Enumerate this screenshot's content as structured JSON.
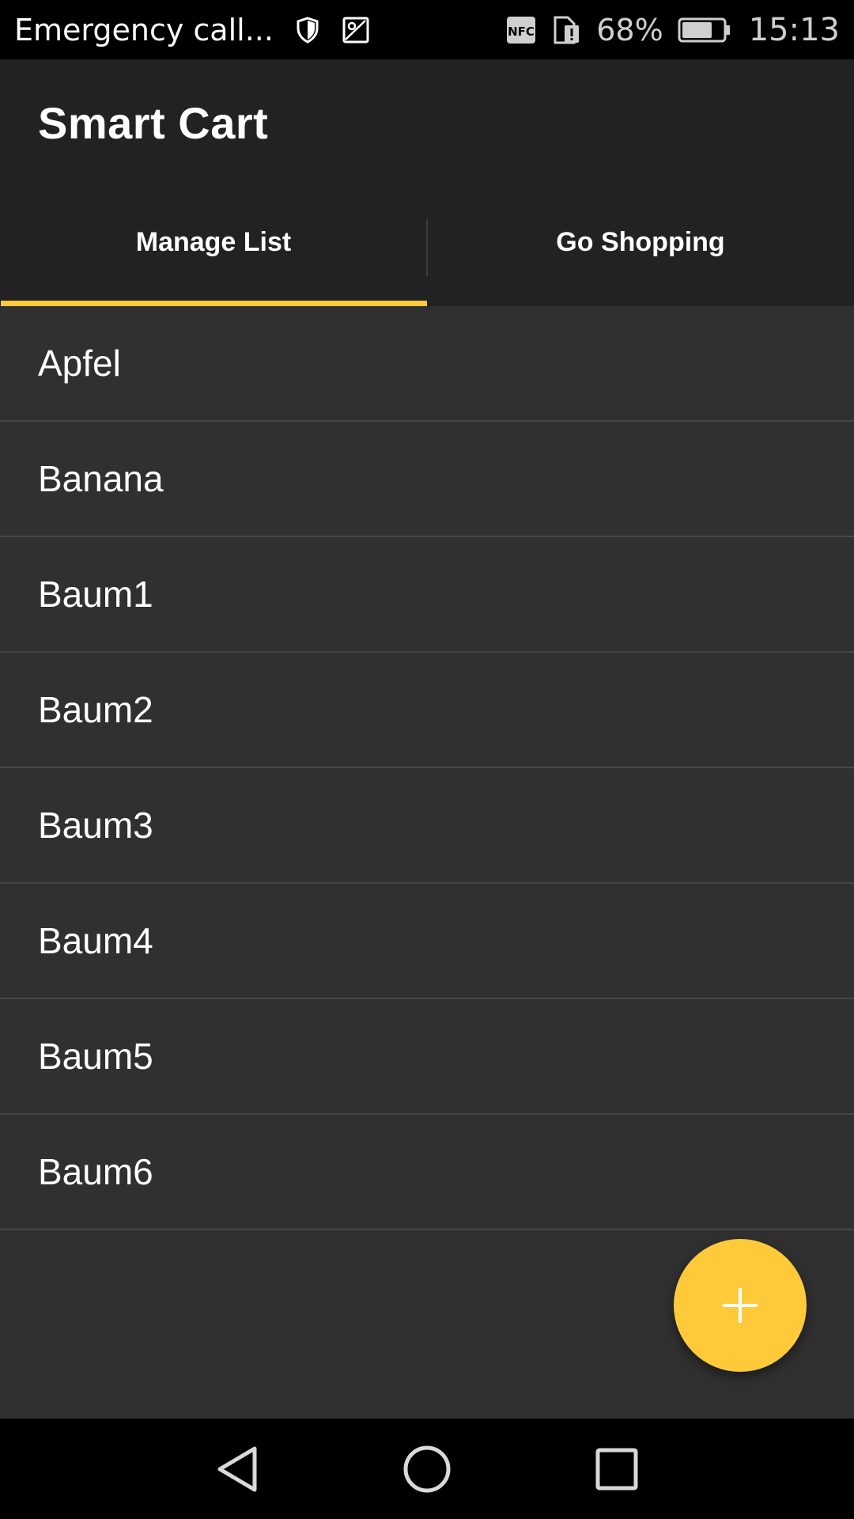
{
  "status_bar": {
    "carrier_text": "Emergency call...",
    "battery_percent": "68%",
    "time": "15:13",
    "icons": [
      "shield-icon",
      "image-icon",
      "nfc-icon",
      "sim-alert-icon",
      "battery-icon"
    ]
  },
  "app_bar": {
    "title": "Smart Cart"
  },
  "tabs": [
    {
      "label": "Manage List",
      "active": true
    },
    {
      "label": "Go Shopping",
      "active": false
    }
  ],
  "list": {
    "items": [
      "Apfel",
      "Banana",
      "Baum1",
      "Baum2",
      "Baum3",
      "Baum4",
      "Baum5",
      "Baum6"
    ]
  },
  "fab": {
    "icon": "plus-icon"
  },
  "nav_bar": {
    "buttons": [
      "back-icon",
      "home-icon",
      "recents-icon"
    ]
  },
  "colors": {
    "accent": "#ffca3a",
    "app_bar_bg": "#222222",
    "list_bg": "#303030",
    "divider": "#474747"
  }
}
